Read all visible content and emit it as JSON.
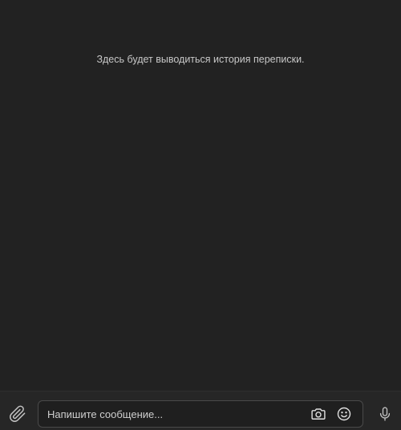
{
  "history": {
    "placeholder_text": "Здесь будет выводиться история переписки."
  },
  "composer": {
    "input_placeholder": "Напишите сообщение...",
    "input_value": "",
    "icons": {
      "attach": "paperclip-icon",
      "camera": "camera-icon",
      "emoji": "smiley-icon",
      "mic": "microphone-icon"
    }
  },
  "colors": {
    "background": "#222222",
    "composer_background": "#262626",
    "input_border": "#4a4a4a",
    "text": "#c8c8c8",
    "icon": "#d0d0d0"
  }
}
